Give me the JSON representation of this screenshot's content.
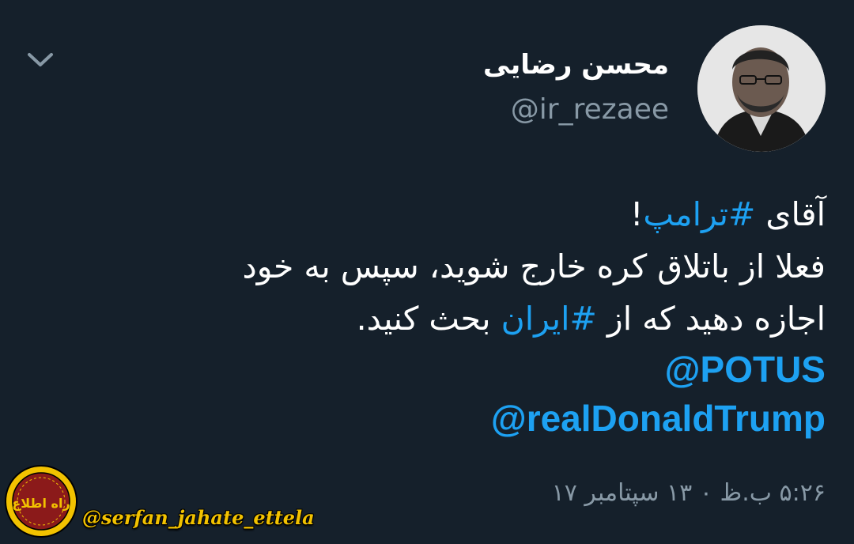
{
  "header": {
    "display_name": "محسن رضایی",
    "handle": "@ir_rezaee",
    "avatar_icon": "user-avatar-photo",
    "menu_icon": "chevron-down-icon"
  },
  "tweet": {
    "line1_prefix": "آقای ",
    "line1_hashtag": "#ترامپ",
    "line1_suffix": "!",
    "line2": "فعلا از باتلاق کره خارج شوید، سپس به خود",
    "line3_prefix": "اجازه دهید که از ",
    "line3_hashtag": "#ایران",
    "line3_suffix": " بحث کنید.",
    "mention1": "@POTUS",
    "mention2": "@realDonaldTrump",
    "timestamp": "۵:۲۶ ب.ظ ۰ ۱۳ سپتامبر ۱۷"
  },
  "watermark": {
    "text": "@serfan_jahate_ettela",
    "logo_text": "راه اطلاع"
  },
  "colors": {
    "background": "#15202b",
    "link": "#1da1f2",
    "secondary_text": "#8899a6",
    "watermark": "#f2c200"
  }
}
